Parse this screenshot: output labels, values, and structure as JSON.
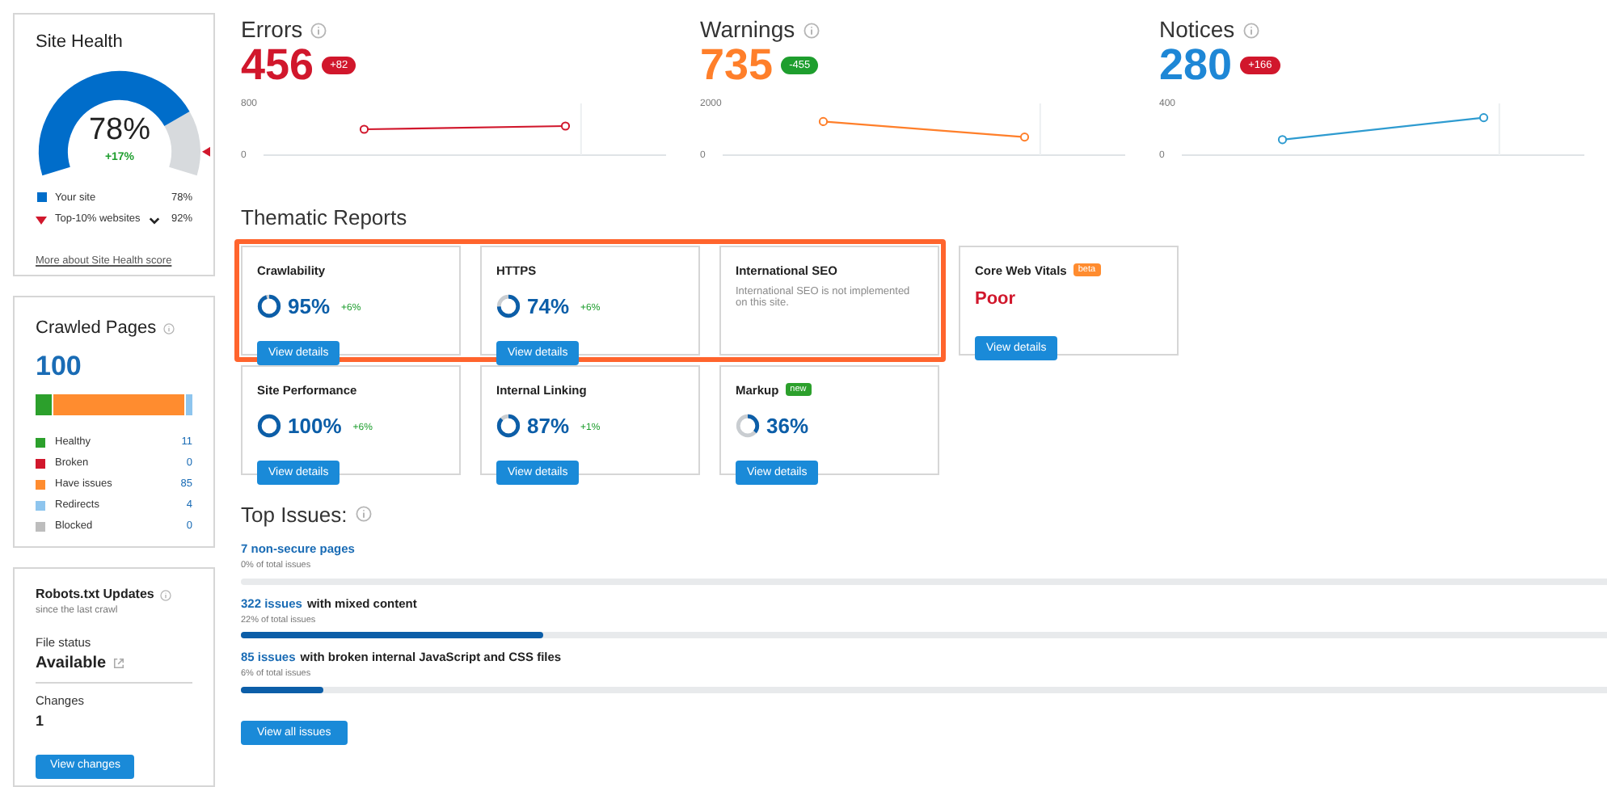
{
  "site_health": {
    "title": "Site Health",
    "value": "78%",
    "change": "+17%",
    "legend": [
      {
        "kind": "square",
        "label": "Your site",
        "value": "78%",
        "color": "#006dca"
      },
      {
        "kind": "triangle",
        "label": "Top-10% websites",
        "value": "92%",
        "color": "#d1172c"
      }
    ],
    "link": "More about Site Health score"
  },
  "crawled_pages": {
    "title": "Crawled Pages",
    "total": "100",
    "items": [
      {
        "label": "Healthy",
        "count": "11",
        "color": "#2ca02c"
      },
      {
        "label": "Broken",
        "count": "0",
        "color": "#d1172c"
      },
      {
        "label": "Have issues",
        "count": "85",
        "color": "#ff8c2f"
      },
      {
        "label": "Redirects",
        "count": "4",
        "color": "#8ec5ee"
      },
      {
        "label": "Blocked",
        "count": "0",
        "color": "#bdbdbd"
      }
    ]
  },
  "robots": {
    "title": "Robots.txt Updates",
    "subtitle": "since the last crawl",
    "file_status_label": "File status",
    "file_status": "Available",
    "changes_label": "Changes",
    "changes": "1",
    "button": "View changes"
  },
  "metrics": [
    {
      "title": "Errors",
      "value": "456",
      "color": "#d1172c",
      "delta": {
        "text": "+82",
        "color": "#d1172c"
      },
      "chart_data": {
        "type": "line",
        "yticks": [
          0,
          800
        ],
        "ylim": [
          0,
          800
        ],
        "series": [
          {
            "color": "#d1172c",
            "marker": "circle",
            "values": [
              400,
              450
            ]
          }
        ]
      }
    },
    {
      "title": "Warnings",
      "value": "735",
      "color": "#ff7f2a",
      "delta": {
        "text": "-455",
        "color": "#1e9e2e"
      },
      "chart_data": {
        "type": "line",
        "yticks": [
          0,
          2000
        ],
        "ylim": [
          0,
          2000
        ],
        "series": [
          {
            "color": "#ff7f2a",
            "marker": "circle",
            "values": [
              1300,
              700
            ]
          }
        ]
      }
    },
    {
      "title": "Notices",
      "value": "280",
      "color": "#1e87d6",
      "delta": {
        "text": "+166",
        "color": "#d1172c"
      },
      "chart_data": {
        "type": "line",
        "yticks": [
          0,
          400
        ],
        "ylim": [
          0,
          400
        ],
        "series": [
          {
            "color": "#2e9bd0",
            "marker": "circle",
            "values": [
              120,
              290
            ]
          }
        ]
      }
    }
  ],
  "thematic_reports": {
    "title": "Thematic Reports",
    "rows": [
      {
        "groups": [
          {
            "highlighted": true,
            "cards": [
              {
                "kind": "score",
                "title": "Crawlability",
                "value": "95%",
                "change": "+6%",
                "button": "View details"
              },
              {
                "kind": "score",
                "title": "HTTPS",
                "value": "74%",
                "change": "+6%",
                "button": "View details"
              },
              {
                "kind": "message",
                "title": "International SEO",
                "message": "International SEO is not implemented on this site."
              }
            ]
          },
          {
            "highlighted": false,
            "cards": [
              {
                "kind": "status",
                "title": "Core Web Vitals",
                "badge": {
                  "text": "beta",
                  "color": "#ff8c2f"
                },
                "status": "Poor",
                "button": "View details"
              }
            ]
          }
        ]
      },
      {
        "groups": [
          {
            "highlighted": false,
            "cards": [
              {
                "kind": "score",
                "title": "Site Performance",
                "value": "100%",
                "change": "+6%",
                "button": "View details"
              },
              {
                "kind": "score",
                "title": "Internal Linking",
                "value": "87%",
                "change": "+1%",
                "button": "View details"
              },
              {
                "kind": "score",
                "title": "Markup",
                "badge": {
                  "text": "new",
                  "color": "#2ca02c"
                },
                "value": "36%",
                "button": "View details"
              }
            ]
          }
        ]
      }
    ]
  },
  "top_issues": {
    "title": "Top Issues:",
    "items": [
      {
        "link": "7 non-secure pages",
        "share": "0% of total issues"
      },
      {
        "link": "322 issues",
        "text": "with mixed content",
        "share": "22% of total issues",
        "level": 0.22
      },
      {
        "link": "85 issues",
        "text": "with broken internal JavaScript and CSS files",
        "share": "6% of total issues",
        "level": 0.06
      }
    ],
    "button": "View all issues"
  }
}
